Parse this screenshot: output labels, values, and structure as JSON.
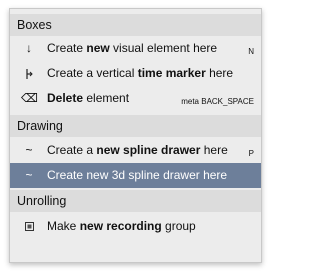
{
  "sections": {
    "boxes": "Boxes",
    "drawing": "Drawing",
    "unrolling": "Unrolling"
  },
  "items": {
    "create_box": {
      "icon": "arrow-down-icon",
      "pre": "Create ",
      "bold": "new",
      "post": " visual element here",
      "shortcut": "N"
    },
    "time_marker": {
      "icon": "time-marker-icon",
      "pre": "Create a vertical ",
      "bold": "time marker",
      "post": " here",
      "shortcut": ""
    },
    "delete": {
      "icon": "backspace-icon",
      "pre": "",
      "bold": "Delete",
      "post": " element",
      "shortcut": "meta BACK_SPACE"
    },
    "spline": {
      "icon": "tilde-icon",
      "pre": "Create a ",
      "bold": "new spline drawer",
      "post": " here",
      "shortcut": "P"
    },
    "spline3d": {
      "icon": "tilde-icon",
      "pre": "Create new 3d spline drawer here",
      "bold": "",
      "post": "",
      "shortcut": ""
    },
    "recording": {
      "icon": "recording-group-icon",
      "pre": "Make ",
      "bold": "new recording",
      "post": " group",
      "shortcut": ""
    }
  },
  "colors": {
    "highlight": "#6d7f9a",
    "section_bg": "#dcdcdc",
    "menu_bg": "#ececec"
  }
}
